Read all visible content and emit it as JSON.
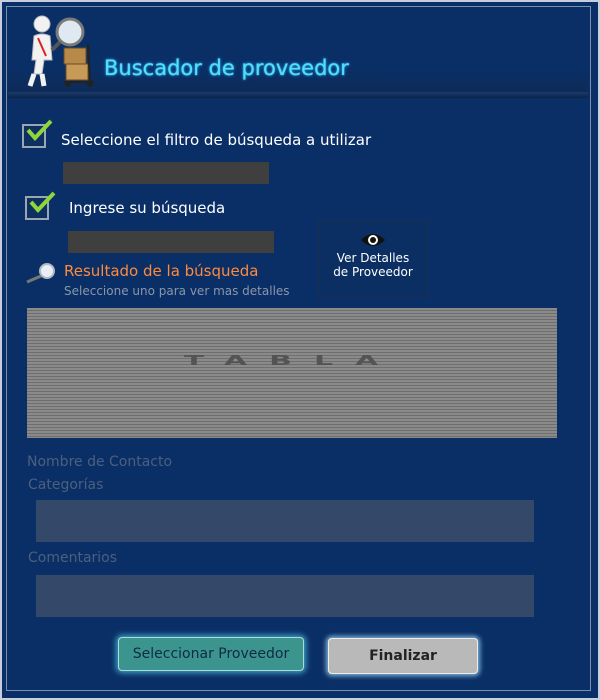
{
  "header": {
    "title": "Buscador de proveedor",
    "logo_icon": "supplier-search-icon"
  },
  "filter": {
    "checked": true,
    "label": "Seleccione el filtro de búsqueda a utilizar",
    "input_value": ""
  },
  "search": {
    "checked": true,
    "label": "Ingrese su búsqueda",
    "input_value": ""
  },
  "results": {
    "icon": "magnifier-icon",
    "title": "Resultado de la búsqueda",
    "subtitle": "Seleccione uno para ver mas detalles",
    "table_placeholder": "TABLA"
  },
  "details_button": {
    "icon": "eye-icon",
    "line1": "Ver Detalles",
    "line2": "de Proveedor"
  },
  "details": {
    "contact_label": "Nombre de  Contacto",
    "categories_label": "Categorías",
    "comments_label": "Comentarios"
  },
  "actions": {
    "select_label": "Seleccionar Proveedor",
    "finish_label": "Finalizar"
  },
  "colors": {
    "background": "#0a2f66",
    "title": "#4fe0f5",
    "result_title": "#ff8a3d",
    "check": "#8fd63a"
  }
}
